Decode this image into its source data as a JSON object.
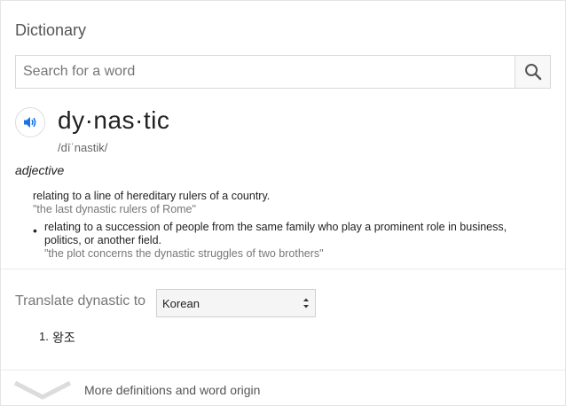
{
  "header": {
    "title": "Dictionary"
  },
  "search": {
    "placeholder": "Search for a word",
    "value": ""
  },
  "entry": {
    "word": "dy·nas·tic",
    "phonetic": "/dīˈnastik/",
    "part_of_speech": "adjective",
    "definitions": [
      {
        "text": "relating to a line of hereditary rulers of a country.",
        "example": "\"the last dynastic rulers of Rome\""
      },
      {
        "text": "relating to a succession of people from the same family who play a prominent role in business, politics, or another field.",
        "example": "\"the plot concerns the dynastic struggles of two brothers\""
      }
    ]
  },
  "translate": {
    "label": "Translate dynastic to",
    "selected_language": "Korean",
    "results": [
      {
        "number": "1.",
        "text": "왕조"
      }
    ]
  },
  "footer": {
    "more_label": "More definitions and word origin"
  },
  "colors": {
    "accent": "#1a73e8",
    "muted": "#777777",
    "border": "#d9d9d9"
  }
}
